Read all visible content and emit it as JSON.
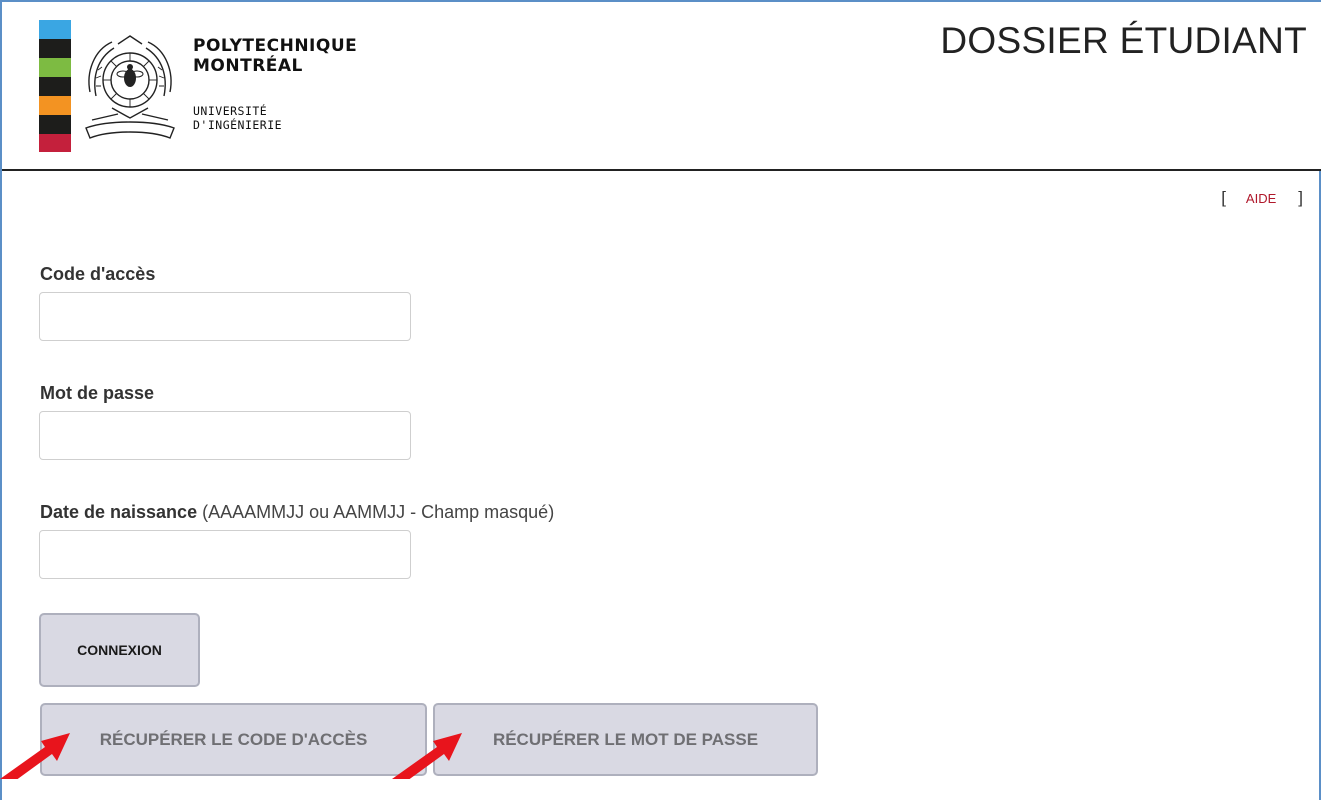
{
  "header": {
    "logo_name_line1": "POLYTECHNIQUE",
    "logo_name_line2": "MONTRÉAL",
    "logo_sub_line1": "UNIVERSITÉ",
    "logo_sub_line2": "D'INGÉNIERIE",
    "app_title": "DOSSIER ÉTUDIANT",
    "brand_colors": [
      "#3aa6e3",
      "#1d1d1b",
      "#7dbb42",
      "#1d1d1b",
      "#f39322",
      "#1d1d1b",
      "#c4203c"
    ]
  },
  "help": {
    "open_bracket": "[",
    "link_label": "AIDE",
    "close_bracket": "]"
  },
  "form": {
    "access_code": {
      "label": "Code d'accès",
      "value": ""
    },
    "password": {
      "label": "Mot de passe",
      "value": ""
    },
    "birth_date": {
      "label": "Date de naissance",
      "hint": "(AAAAMMJJ ou AAMMJJ - Champ masqué)",
      "value": ""
    },
    "login_button": "CONNEXION",
    "recover_code_button": "RÉCUPÉRER LE CODE D'ACCÈS",
    "recover_password_button": "RÉCUPÉRER LE MOT DE PASSE"
  },
  "annotations": {
    "arrow_color": "#e8141c"
  }
}
